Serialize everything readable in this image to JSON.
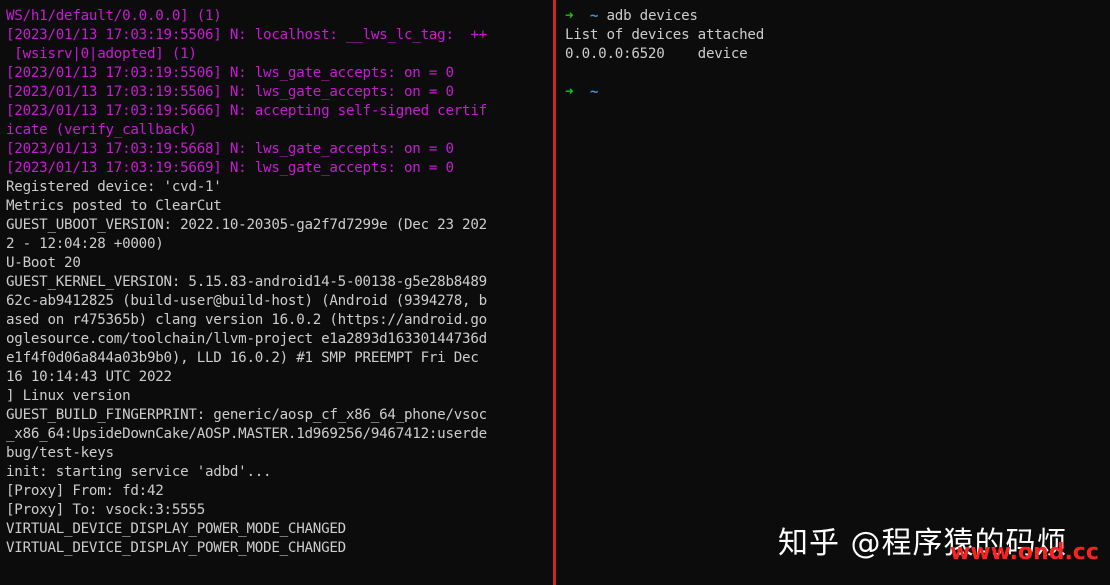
{
  "left_terminal": {
    "lines": [
      {
        "text": "WS/h1/default/0.0.0.0] (1)",
        "kind": "log"
      },
      {
        "text": "[2023/01/13 17:03:19:5506] N: localhost: __lws_lc_tag:  ++",
        "kind": "log"
      },
      {
        "text": " [wsisrv|0|adopted] (1)",
        "kind": "log"
      },
      {
        "text": "[2023/01/13 17:03:19:5506] N: lws_gate_accepts: on = 0",
        "kind": "log"
      },
      {
        "text": "[2023/01/13 17:03:19:5506] N: lws_gate_accepts: on = 0",
        "kind": "log"
      },
      {
        "text": "[2023/01/13 17:03:19:5666] N: accepting self-signed certif",
        "kind": "log"
      },
      {
        "text": "icate (verify_callback)",
        "kind": "log"
      },
      {
        "text": "[2023/01/13 17:03:19:5668] N: lws_gate_accepts: on = 0",
        "kind": "log"
      },
      {
        "text": "[2023/01/13 17:03:19:5669] N: lws_gate_accepts: on = 0",
        "kind": "log"
      },
      {
        "text": "Registered device: 'cvd-1'",
        "kind": "plain"
      },
      {
        "text": "Metrics posted to ClearCut",
        "kind": "plain"
      },
      {
        "text": "GUEST_UBOOT_VERSION: 2022.10-20305-ga2f7d7299e (Dec 23 202",
        "kind": "plain"
      },
      {
        "text": "2 - 12:04:28 +0000)",
        "kind": "plain"
      },
      {
        "text": "U-Boot 20",
        "kind": "plain"
      },
      {
        "text": "GUEST_KERNEL_VERSION: 5.15.83-android14-5-00138-g5e28b8489",
        "kind": "plain"
      },
      {
        "text": "62c-ab9412825 (build-user@build-host) (Android (9394278, b",
        "kind": "plain"
      },
      {
        "text": "ased on r475365b) clang version 16.0.2 (https://android.go",
        "kind": "plain"
      },
      {
        "text": "oglesource.com/toolchain/llvm-project e1a2893d16330144736d",
        "kind": "plain"
      },
      {
        "text": "e1f4f0d06a844a03b9b0), LLD 16.0.2) #1 SMP PREEMPT Fri Dec",
        "kind": "plain"
      },
      {
        "text": "16 10:14:43 UTC 2022",
        "kind": "plain"
      },
      {
        "text": "] Linux version",
        "kind": "plain"
      },
      {
        "text": "GUEST_BUILD_FINGERPRINT: generic/aosp_cf_x86_64_phone/vsoc",
        "kind": "plain"
      },
      {
        "text": "_x86_64:UpsideDownCake/AOSP.MASTER.1d969256/9467412:userde",
        "kind": "plain"
      },
      {
        "text": "bug/test-keys",
        "kind": "plain"
      },
      {
        "text": "init: starting service 'adbd'...",
        "kind": "plain"
      },
      {
        "text": "[Proxy] From: fd:42",
        "kind": "plain"
      },
      {
        "text": "[Proxy] To: vsock:3:5555",
        "kind": "plain"
      },
      {
        "text": "VIRTUAL_DEVICE_DISPLAY_POWER_MODE_CHANGED",
        "kind": "plain"
      },
      {
        "text": "VIRTUAL_DEVICE_DISPLAY_POWER_MODE_CHANGED",
        "kind": "plain"
      }
    ]
  },
  "right_terminal": {
    "prompt_arrow": "➜",
    "prompt_dir": "~",
    "command": "adb devices",
    "output_header": "List of devices attached",
    "device_line": "0.0.0.0:6520    device",
    "second_prompt_arrow": "➜",
    "second_prompt_dir": "~"
  },
  "watermark": {
    "zhihu": "知乎 @程序猿的码烦",
    "site": "www.ond.cc"
  },
  "colors": {
    "background": "#0c0c0c",
    "log_magenta": "#c71bd3",
    "text": "#cccccc",
    "prompt_green": "#16c60c",
    "prompt_blue": "#3a96dd",
    "divider_red": "#c42b1c"
  }
}
